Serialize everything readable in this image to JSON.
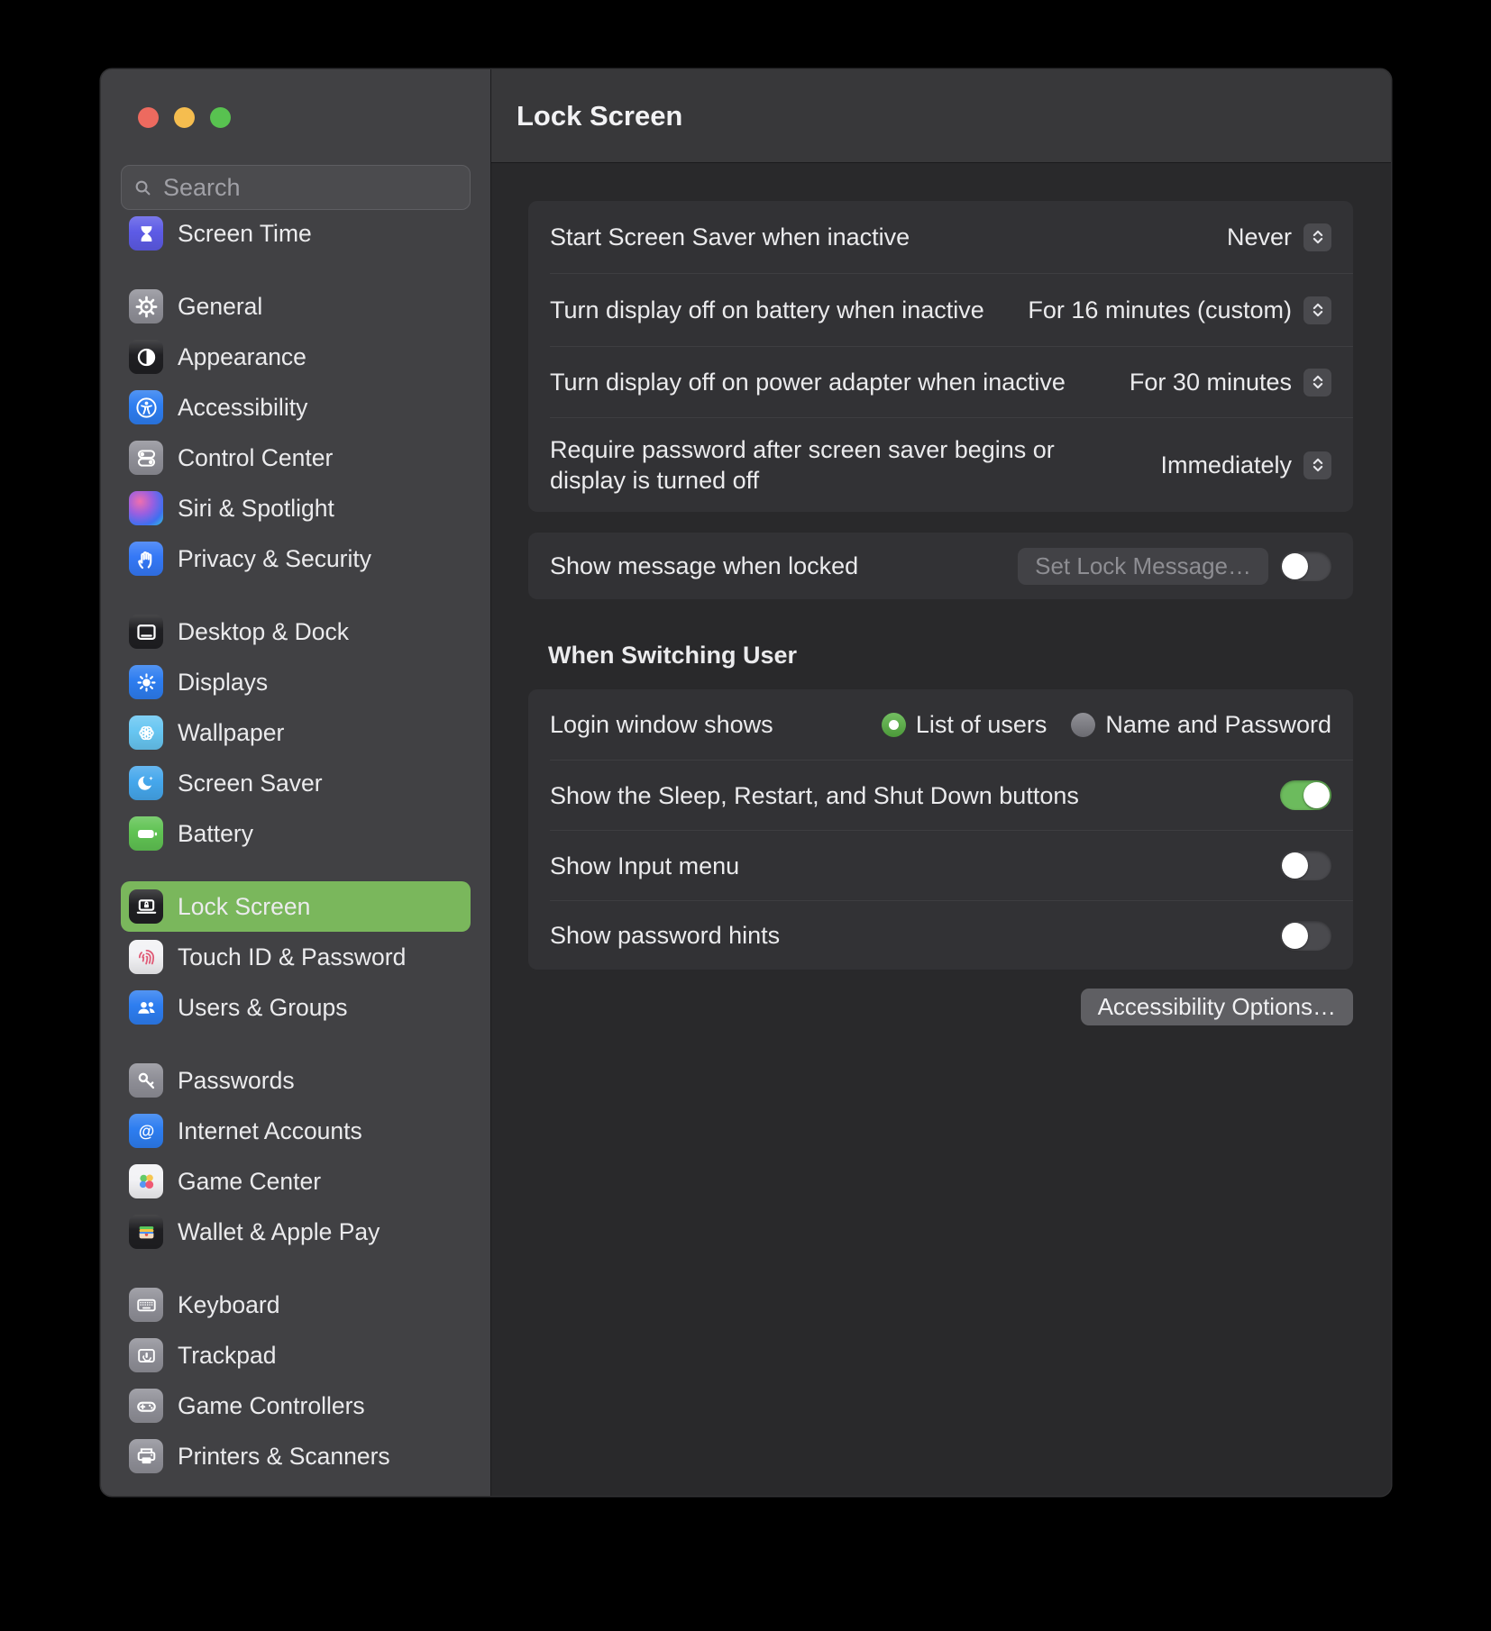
{
  "colors": {
    "traffic_red": "#ed6a5f",
    "traffic_yellow": "#f5bd4f",
    "traffic_green": "#58c250",
    "sidebar_selection_green": "#7ab75c",
    "toggle_on_green": "#6cbb5d",
    "radio_selected_green": "#58b243"
  },
  "sidebar": {
    "search": {
      "placeholder": "Search"
    },
    "groups": [
      {
        "items": [
          {
            "label": "Screen Time",
            "icon": "screen-time",
            "color": "#5d5be6"
          }
        ]
      },
      {
        "items": [
          {
            "label": "General",
            "icon": "gear",
            "color": "#8f8f97"
          },
          {
            "label": "Appearance",
            "icon": "appearance",
            "color": "#1f1f22"
          },
          {
            "label": "Accessibility",
            "icon": "accessibility",
            "color": "#2d7df0"
          },
          {
            "label": "Control Center",
            "icon": "control-center",
            "color": "#8f8f97"
          },
          {
            "label": "Siri & Spotlight",
            "icon": "siri",
            "color": "#9a5fe0"
          },
          {
            "label": "Privacy & Security",
            "icon": "privacy-hand",
            "color": "#3478f6"
          }
        ]
      },
      {
        "items": [
          {
            "label": "Desktop & Dock",
            "icon": "desktop-dock",
            "color": "#1f1f22"
          },
          {
            "label": "Displays",
            "icon": "displays-sun",
            "color": "#2d7df0"
          },
          {
            "label": "Wallpaper",
            "icon": "wallpaper-flower",
            "color": "#67c6f2"
          },
          {
            "label": "Screen Saver",
            "icon": "screensaver-moon",
            "color": "#45a7ec"
          },
          {
            "label": "Battery",
            "icon": "battery",
            "color": "#60c353"
          }
        ]
      },
      {
        "items": [
          {
            "label": "Lock Screen",
            "icon": "lock-screen",
            "color": "#1f1f22",
            "selected": true
          },
          {
            "label": "Touch ID & Password",
            "icon": "touch-id",
            "color": "#f2f2f5"
          },
          {
            "label": "Users & Groups",
            "icon": "users-groups",
            "color": "#2d7df0"
          }
        ]
      },
      {
        "items": [
          {
            "label": "Passwords",
            "icon": "passwords-key",
            "color": "#8f8f97"
          },
          {
            "label": "Internet Accounts",
            "icon": "at-sign",
            "color": "#2d7df0"
          },
          {
            "label": "Game Center",
            "icon": "game-center",
            "color": "#f2f2f5"
          },
          {
            "label": "Wallet & Apple Pay",
            "icon": "wallet",
            "color": "#1f1f22"
          }
        ]
      },
      {
        "items": [
          {
            "label": "Keyboard",
            "icon": "keyboard",
            "color": "#8f8f97"
          },
          {
            "label": "Trackpad",
            "icon": "trackpad",
            "color": "#8f8f97"
          },
          {
            "label": "Game Controllers",
            "icon": "game-controller",
            "color": "#8f8f97"
          },
          {
            "label": "Printers & Scanners",
            "icon": "printer",
            "color": "#8f8f97"
          }
        ]
      }
    ]
  },
  "main": {
    "title": "Lock Screen",
    "inactivity_card": {
      "rows": [
        {
          "label": "Start Screen Saver when inactive",
          "value": "Never"
        },
        {
          "label": "Turn display off on battery when inactive",
          "value": "For 16 minutes (custom)"
        },
        {
          "label": "Turn display off on power adapter when inactive",
          "value": "For 30 minutes"
        },
        {
          "label": "Require password after screen saver begins or display is turned off",
          "value": "Immediately"
        }
      ]
    },
    "lock_message_card": {
      "label": "Show message when locked",
      "button_label": "Set Lock Message…",
      "button_enabled": false,
      "toggle_on": false
    },
    "when_switching_user": {
      "heading": "When Switching User",
      "login_row": {
        "label": "Login window shows",
        "options": [
          {
            "label": "List of users",
            "selected": true
          },
          {
            "label": "Name and Password",
            "selected": false
          }
        ]
      },
      "toggle_rows": [
        {
          "label": "Show the Sleep, Restart, and Shut Down buttons",
          "on": true
        },
        {
          "label": "Show Input menu",
          "on": false
        },
        {
          "label": "Show password hints",
          "on": false
        }
      ]
    },
    "accessibility_button_label": "Accessibility Options…"
  }
}
